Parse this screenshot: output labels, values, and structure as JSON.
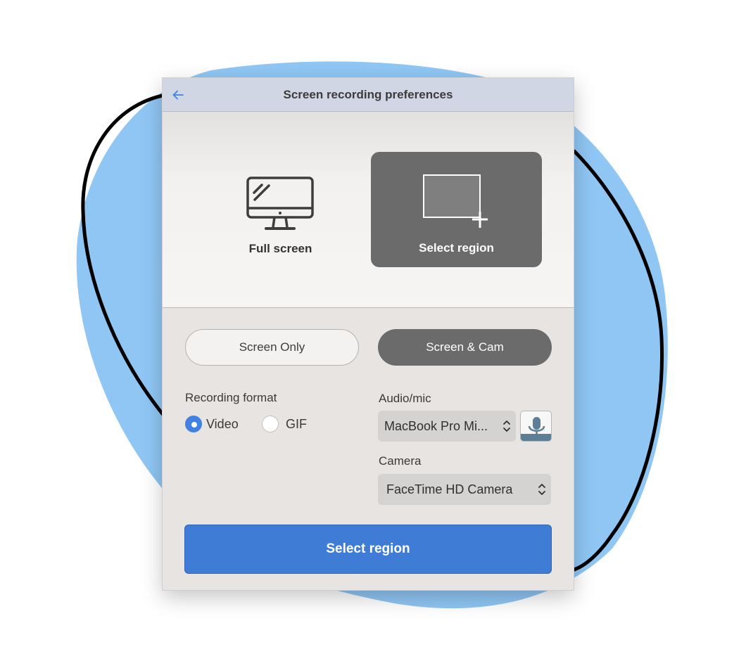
{
  "window": {
    "title": "Screen recording preferences"
  },
  "icons": {
    "back": "left-arrow-icon",
    "full_screen": "monitor-icon",
    "select_region": "region-select-icon",
    "mic": "microphone-icon",
    "chevrons": "up-down-chevron-icon"
  },
  "capture_modes": {
    "full_screen_label": "Full screen",
    "select_region_label": "Select region",
    "selected": "Select region"
  },
  "source_toggle": {
    "screen_only_label": "Screen Only",
    "screen_cam_label": "Screen & Cam",
    "selected": "Screen & Cam"
  },
  "recording_format": {
    "label": "Recording format",
    "options": [
      "Video",
      "GIF"
    ],
    "selected": "Video"
  },
  "audio": {
    "label": "Audio/mic",
    "selected_value": "MacBook Pro Mi..."
  },
  "camera": {
    "label": "Camera",
    "selected_value": "FaceTime HD Camera"
  },
  "primary_action": {
    "label": "Select region"
  },
  "colors": {
    "accent": "#3f7cd6",
    "radio_selected": "#3f82e4",
    "selected_card": "#6b6b6b",
    "blob": "#8fc6f4",
    "titlebar": "#d0d6e3",
    "window_bg": "#e7e4e2"
  }
}
